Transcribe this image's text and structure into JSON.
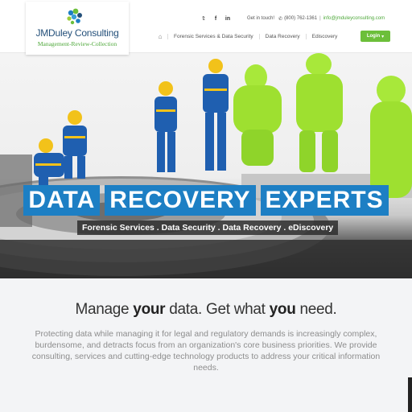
{
  "header": {
    "logo_name": "JMDuley Consulting",
    "logo_tagline": "Management-Review-Collection",
    "contact": {
      "social_icons": [
        "twitter-icon",
        "facebook-icon",
        "linkedin-icon"
      ],
      "social_glyphs": [
        "𝕥",
        "f",
        "in"
      ],
      "get_in_touch": "Get in touch!",
      "phone": "(800) 762-1361",
      "separator": "|",
      "email": "info@jmduleyconsulting.com"
    },
    "nav": {
      "home_icon": "home-icon",
      "items": [
        "Forensic Services & Data Security",
        "Data Recovery",
        "Ediscovery"
      ],
      "login_label": "Login"
    }
  },
  "hero": {
    "title_words": [
      "DATA",
      "RECOVERY",
      "EXPERTS"
    ],
    "subtitle": "Forensic Services . Data Security . Data Recovery . eDiscovery"
  },
  "main": {
    "headline_parts": [
      "Manage ",
      "your",
      " data. Get what ",
      "you",
      " need."
    ],
    "paragraph": "Protecting data while managing it for legal and regulatory demands is increasingly complex, burdensome, and detracts focus from an organization's core business priorities. We provide consulting, services and cutting-edge technology products to address your critical information needs."
  },
  "colors": {
    "brand_blue": "#1d7fc4",
    "brand_green": "#6cbf3a",
    "logo_text": "#24507a"
  }
}
